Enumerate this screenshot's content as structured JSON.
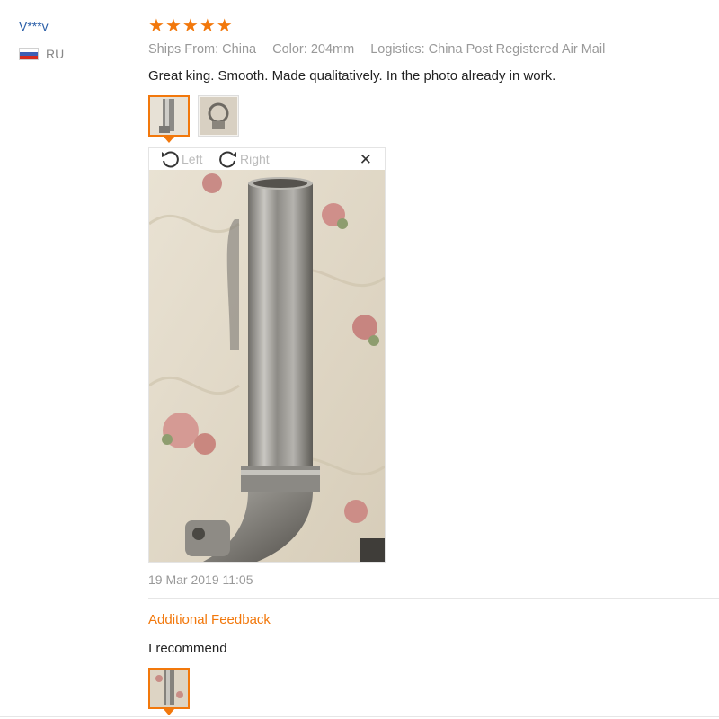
{
  "reviewer": {
    "name": "V***v",
    "country_code": "RU",
    "flag_colors": [
      "#ffffff",
      "#3d5fb5",
      "#d52b1e"
    ]
  },
  "review": {
    "rating": 5,
    "rating_max": 5,
    "accent_color": "#f2780c",
    "ships_from": "Ships From: China",
    "color": "Color: 204mm",
    "logistics": "Logistics: China Post Registered Air Mail",
    "text": "Great king. Smooth. Made qualitatively. In the photo already in work.",
    "date": "19 Mar 2019 11:05"
  },
  "viewer": {
    "rotate_left_label": "Left",
    "rotate_right_label": "Right",
    "close_icon": "close-icon",
    "rotate_left_icon": "rotate-left-icon",
    "rotate_right_icon": "rotate-right-icon"
  },
  "additional_feedback": {
    "heading": "Additional Feedback",
    "text": "I recommend"
  }
}
